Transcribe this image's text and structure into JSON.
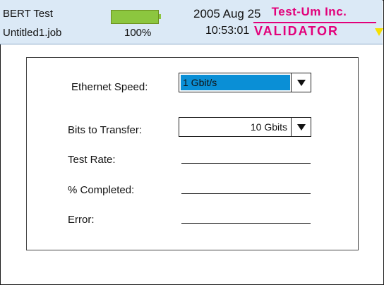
{
  "header": {
    "title": "BERT Test",
    "job_name": "Untitled1.job",
    "battery": {
      "percent_label": "100%",
      "level": 1.0,
      "color": "#8cc63f"
    },
    "date": "2005 Aug 25",
    "time": "10:53:01",
    "brand": "Test-Um Inc.",
    "product": "VALIDATOR",
    "brand_color": "#e2007a"
  },
  "form": {
    "ethernet_speed": {
      "label": "Ethernet Speed:",
      "value": "1 Gbit/s",
      "highlight": "#0a8fd6"
    },
    "bits_to_transfer": {
      "label": "Bits to Transfer:",
      "value": "10 Gbits"
    },
    "test_rate": {
      "label": "Test Rate:",
      "value": ""
    },
    "percent_completed": {
      "label": "% Completed:",
      "value": ""
    },
    "error": {
      "label": "Error:",
      "value": ""
    }
  }
}
